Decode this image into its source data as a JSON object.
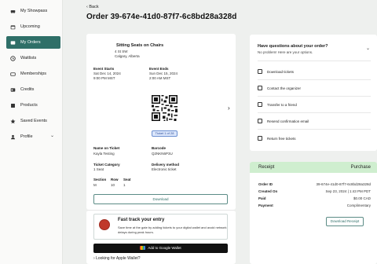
{
  "sidebar": {
    "items": [
      {
        "label": "My Showpass",
        "icon": "car-icon"
      },
      {
        "label": "Upcoming",
        "icon": "calendar-icon"
      },
      {
        "label": "My Orders",
        "icon": "folder-icon",
        "active": true
      },
      {
        "label": "Waitlists",
        "icon": "clock-icon"
      },
      {
        "label": "Memberships",
        "icon": "card-icon"
      },
      {
        "label": "Credits",
        "icon": "credit-icon"
      },
      {
        "label": "Products",
        "icon": "box-icon"
      },
      {
        "label": "Saved Events",
        "icon": "star-icon"
      },
      {
        "label": "Profile",
        "icon": "user-icon"
      }
    ]
  },
  "header": {
    "back_label": "Back",
    "title": "Order 39-674e-41d0-87f7-6c8bd28a328d"
  },
  "ticket": {
    "event_name": "Sitting Seats on Chairs",
    "address1": "4 St SW",
    "address2": "Calgary, Alberta",
    "starts_label": "Event Starts",
    "starts_date": "Sat Dec 14, 2024",
    "starts_time": "9:00 PM MST",
    "ends_label": "Event Ends",
    "ends_date": "Sun Dec 15, 2024",
    "ends_time": "2:00 AM MST",
    "ticket_badge": "Ticket 1 of 28",
    "name_label": "Name on Ticket",
    "name_value": "Kayla Testing",
    "barcode_label": "Barcode",
    "barcode_value": "Q2NKN6P3U",
    "category_label": "Ticket Category",
    "category_value": "1 Seat",
    "delivery_label": "Delivery method",
    "delivery_value": "Electronic ticket",
    "section_label": "Section",
    "section_value": "M",
    "row_label": "Row",
    "row_value": "10",
    "seat_label": "Seat",
    "seat_value": "1",
    "download_label": "Download"
  },
  "fast_track": {
    "title": "Fast track your entry",
    "text": "Save time at the gate by adding tickets to your digital wallet and avoid network delays during peak hours.",
    "google_wallet_label": "Add to Google Wallet",
    "apple_link": "Looking for Apple Wallet?"
  },
  "questions": {
    "title": "Have questions about your order?",
    "subtitle": "No problem! Here are your options.",
    "items": [
      {
        "label": "Download tickets",
        "icon": "download-icon"
      },
      {
        "label": "Contact the organizer",
        "icon": "phone-icon"
      },
      {
        "label": "Transfer to a friend",
        "icon": "transfer-icon"
      },
      {
        "label": "Resend confirmation email",
        "icon": "mail-icon"
      },
      {
        "label": "Return free tickets",
        "icon": "return-icon"
      }
    ]
  },
  "receipt": {
    "header_left": "Receipt",
    "header_right": "Purchase",
    "order_id_label": "Order ID",
    "order_id_value": "39-674e-41d0-87f7-6c8bd28a328d",
    "created_label": "Created On",
    "created_value": "Sep 23, 2024 | 1:43 PM PDT",
    "paid_label": "Paid",
    "paid_value": "$0.00 CAD",
    "payment_label": "Payment",
    "payment_value": "Complimentary",
    "download_receipt_label": "Download Receipt"
  },
  "colors": {
    "accent": "#2f6f68",
    "receipt_header": "#cfeecf",
    "badge_bg": "#dbe6fb"
  }
}
